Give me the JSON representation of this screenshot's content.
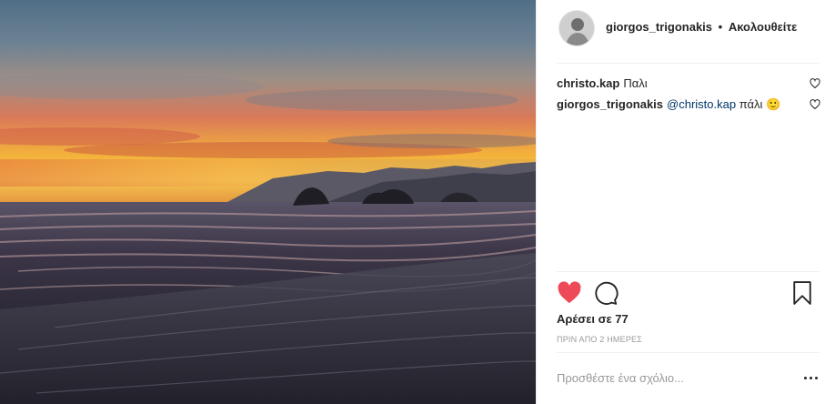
{
  "post": {
    "author": "giorgos_trigonakis",
    "separator": "•",
    "follow_label": "Ακολουθείτε"
  },
  "comments": [
    {
      "user": "christo.kap",
      "text": "Παλι",
      "mention": "",
      "emoji": ""
    },
    {
      "user": "giorgos_trigonakis",
      "mention": "@christo.kap",
      "text": "πάλι",
      "emoji": "🙂"
    }
  ],
  "likes_text": "Αρέσει σε 77",
  "timestamp": "ΠΡΙΝ ΑΠΟ 2 ΗΜΕΡΕΣ",
  "add_comment": {
    "placeholder": "Προσθέστε ένα σχόλιο..."
  },
  "icons": {
    "like": "heart-filled-icon",
    "comment": "comment-bubble-icon",
    "save": "bookmark-icon",
    "comment_like": "heart-outline-icon",
    "more": "more-options-icon"
  },
  "colors": {
    "like_red": "#ed4956",
    "mention_blue": "#003569",
    "muted_gray": "#999999",
    "text_dark": "#262626"
  }
}
